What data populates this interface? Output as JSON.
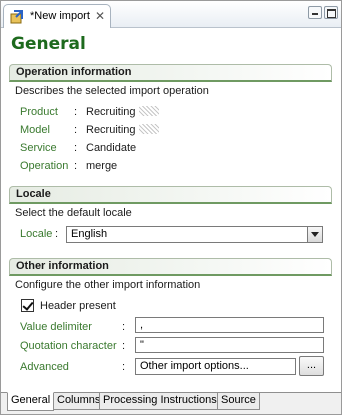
{
  "editor_tab": {
    "title": "*New import",
    "icon": "import-editor-icon",
    "close_icon": "close-icon"
  },
  "window_controls": {
    "minimize_icon": "minimize-icon",
    "maximize_icon": "maximize-icon"
  },
  "page": {
    "title": "General"
  },
  "operation": {
    "header": "Operation information",
    "description": "Describes the selected import operation",
    "fields": [
      {
        "label": "Product",
        "value": "Recruiting"
      },
      {
        "label": "Model",
        "value": "Recruiting"
      },
      {
        "label": "Service",
        "value": "Candidate"
      },
      {
        "label": "Operation",
        "value": "merge"
      }
    ],
    "colon": ":"
  },
  "locale": {
    "header": "Locale",
    "description": "Select the default locale",
    "label": "Locale",
    "colon": ":",
    "selected": "English"
  },
  "other": {
    "header": "Other information",
    "description": "Configure the other import information",
    "header_present_label": "Header present",
    "header_present_checked": true,
    "value_delimiter_label": "Value delimiter",
    "value_delimiter": ",",
    "quotation_label": "Quotation character",
    "quotation": "\"",
    "advanced_label": "Advanced",
    "advanced_value": "Other import options...",
    "advanced_button": "...",
    "colon": ":"
  },
  "page_tabs": [
    {
      "label": "General",
      "active": true
    },
    {
      "label": "Columns",
      "active": false
    },
    {
      "label": "Processing Instructions",
      "active": false
    },
    {
      "label": "Source",
      "active": false
    }
  ],
  "colors": {
    "title_green": "#1d6a1d",
    "label_green": "#3a7a2f",
    "section_rule": "#6f9a62"
  }
}
